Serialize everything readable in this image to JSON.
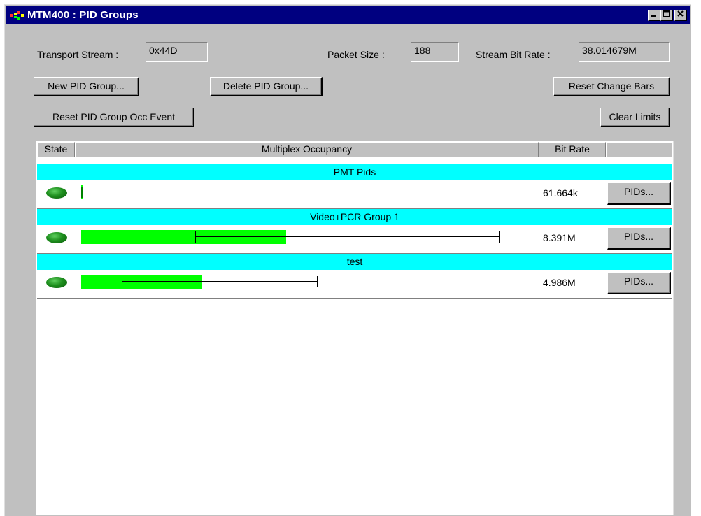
{
  "window": {
    "title": "MTM400 : PID Groups",
    "controls": [
      "minimize",
      "maximize",
      "close"
    ]
  },
  "info": {
    "transport_stream_label": "Transport Stream :",
    "transport_stream_value": "0x44D",
    "packet_size_label": "Packet Size :",
    "packet_size_value": "188",
    "bit_rate_label": "Stream Bit Rate :",
    "bit_rate_value": "38.014679M"
  },
  "buttons": {
    "new_group": "New PID Group...",
    "delete_group": "Delete PID Group...",
    "reset_change_bars": "Reset Change Bars",
    "reset_occ_event": "Reset PID Group Occ Event",
    "clear_limits": "Clear Limits"
  },
  "table": {
    "headers": {
      "state": "State",
      "occupancy": "Multiplex Occupancy",
      "bit_rate": "Bit Rate"
    },
    "groups": [
      {
        "name": "PMT Pids",
        "bit_rate": "61.664k",
        "pids_label": "PIDs...",
        "fill": 0.003,
        "min": 0.0,
        "max": null
      },
      {
        "name": "Video+PCR Group 1",
        "bit_rate": "8.391M",
        "pids_label": "PIDs...",
        "fill": 0.458,
        "min": 0.255,
        "max": 0.933
      },
      {
        "name": "test",
        "bit_rate": "4.986M",
        "pids_label": "PIDs...",
        "fill": 0.27,
        "min": 0.09,
        "max": 0.527
      }
    ]
  },
  "colors": {
    "title_bar": "#000080",
    "group_header": "#00ffff",
    "occupancy_bar": "#00ff00",
    "status_led": "#1e8f1e"
  }
}
